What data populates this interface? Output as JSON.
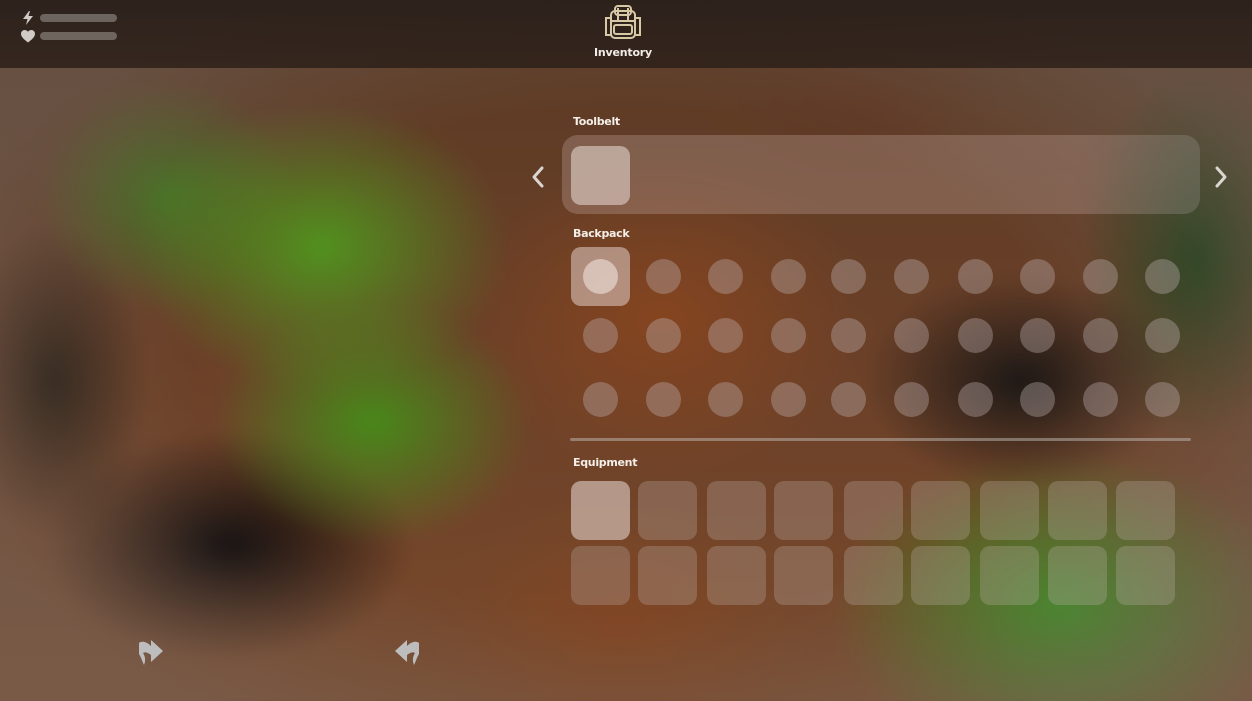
{
  "hud": {
    "stats": [
      {
        "icon": "lightning-icon",
        "level": null
      },
      {
        "icon": "heart-icon",
        "level": null
      }
    ],
    "inventory_icon": "backpack-icon",
    "inventory_title": "Inventory"
  },
  "toolbelt": {
    "label": "Toolbelt",
    "prev_icon": "chevron-left-icon",
    "next_icon": "chevron-right-icon",
    "slot_count": 1
  },
  "backpack": {
    "label": "Backpack",
    "rows": 3,
    "columns": 10
  },
  "equipment": {
    "label": "Equipment",
    "rows": 2,
    "columns": 9
  },
  "controls": {
    "rotate_right_icon": "turn-right-arrow-icon",
    "rotate_left_icon": "turn-left-arrow-icon"
  },
  "colors": {
    "text": "#f4efe9",
    "icon_tint": "#d8c9a6",
    "chevron": "#dcd6d0"
  }
}
